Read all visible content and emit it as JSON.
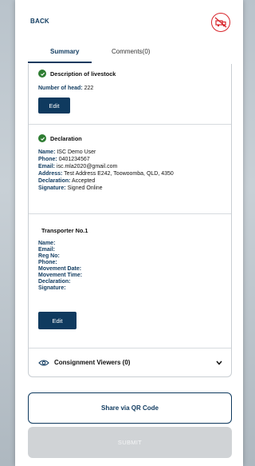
{
  "header": {
    "back_label": "BACK",
    "logo_icon": "no-truck-logo-icon"
  },
  "tabs": [
    {
      "label": "Summary",
      "active": true
    },
    {
      "label": "Comments(0)",
      "active": false
    }
  ],
  "livestock": {
    "title": "Description of livestock",
    "number_of_head_label": "Number of head:",
    "number_of_head_value": "222",
    "edit_label": "Edit"
  },
  "declaration": {
    "title": "Declaration",
    "fields": [
      {
        "label": "Name:",
        "value": "ISC Demo User"
      },
      {
        "label": "Phone:",
        "value": "0401234567"
      },
      {
        "label": "Email:",
        "value": "isc.mla2020@gmail.com"
      },
      {
        "label": "Address:",
        "value": "Test Address E242, Toowoomba, QLD, 4350"
      },
      {
        "label": "Declaration:",
        "value": "Accepted"
      },
      {
        "label": "Signature:",
        "value": "Signed Online"
      }
    ]
  },
  "transporter": {
    "title": "Transporter No.1",
    "fields": [
      {
        "label": "Name:"
      },
      {
        "label": "Email:"
      },
      {
        "label": "Reg No:"
      },
      {
        "label": "Phone:"
      },
      {
        "label": "Movement Date:"
      },
      {
        "label": "Movement Time:"
      },
      {
        "label": "Declaration:"
      },
      {
        "label": "Signature:"
      }
    ],
    "edit_label": "Edit"
  },
  "viewers": {
    "label": "Consignment Viewers (0)"
  },
  "actions": {
    "share_label": "Share via QR Code",
    "submit_label": "SUBMIT"
  },
  "colors": {
    "primary": "#0f3a5f",
    "success": "#2e7d32",
    "brand_red": "#d8242a",
    "disabled": "#d0d3d6"
  }
}
